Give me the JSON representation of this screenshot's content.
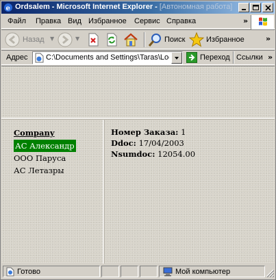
{
  "window": {
    "title_main": "Ordsalem - Microsoft Internet Explorer - ",
    "title_offline": "[Автономная работа]"
  },
  "menu": {
    "items": [
      "Файл",
      "Правка",
      "Вид",
      "Избранное",
      "Сервис",
      "Справка"
    ],
    "overflow": "»"
  },
  "toolbar": {
    "back_label": "Назад",
    "search_label": "Поиск",
    "favorites_label": "Избранное",
    "overflow": "»"
  },
  "address": {
    "label": "Адрес",
    "value": "C:\\Documents and Settings\\Taras\\Local Se",
    "go_label": "Переход",
    "links_label": "Ссылки",
    "overflow": "»"
  },
  "left_pane": {
    "heading": "Company",
    "items": [
      "АС Александр",
      "ООО Паруса",
      "АС Летазры"
    ],
    "selected_index": 0,
    "selected_color": "#008000"
  },
  "right_pane": {
    "order_label": "Номер Заказа:",
    "order_value": "1",
    "ddoc_label": "Ddoc:",
    "ddoc_value": "17/04/2003",
    "nsumdoc_label": "Nsumdoc:",
    "nsumdoc_value": "12054.00"
  },
  "status": {
    "left_text": "Готово",
    "zone_text": "Мой компьютер"
  },
  "colors": {
    "title_start": "#0a246a",
    "title_end": "#a6caf0",
    "chrome": "#d4d0c8"
  }
}
